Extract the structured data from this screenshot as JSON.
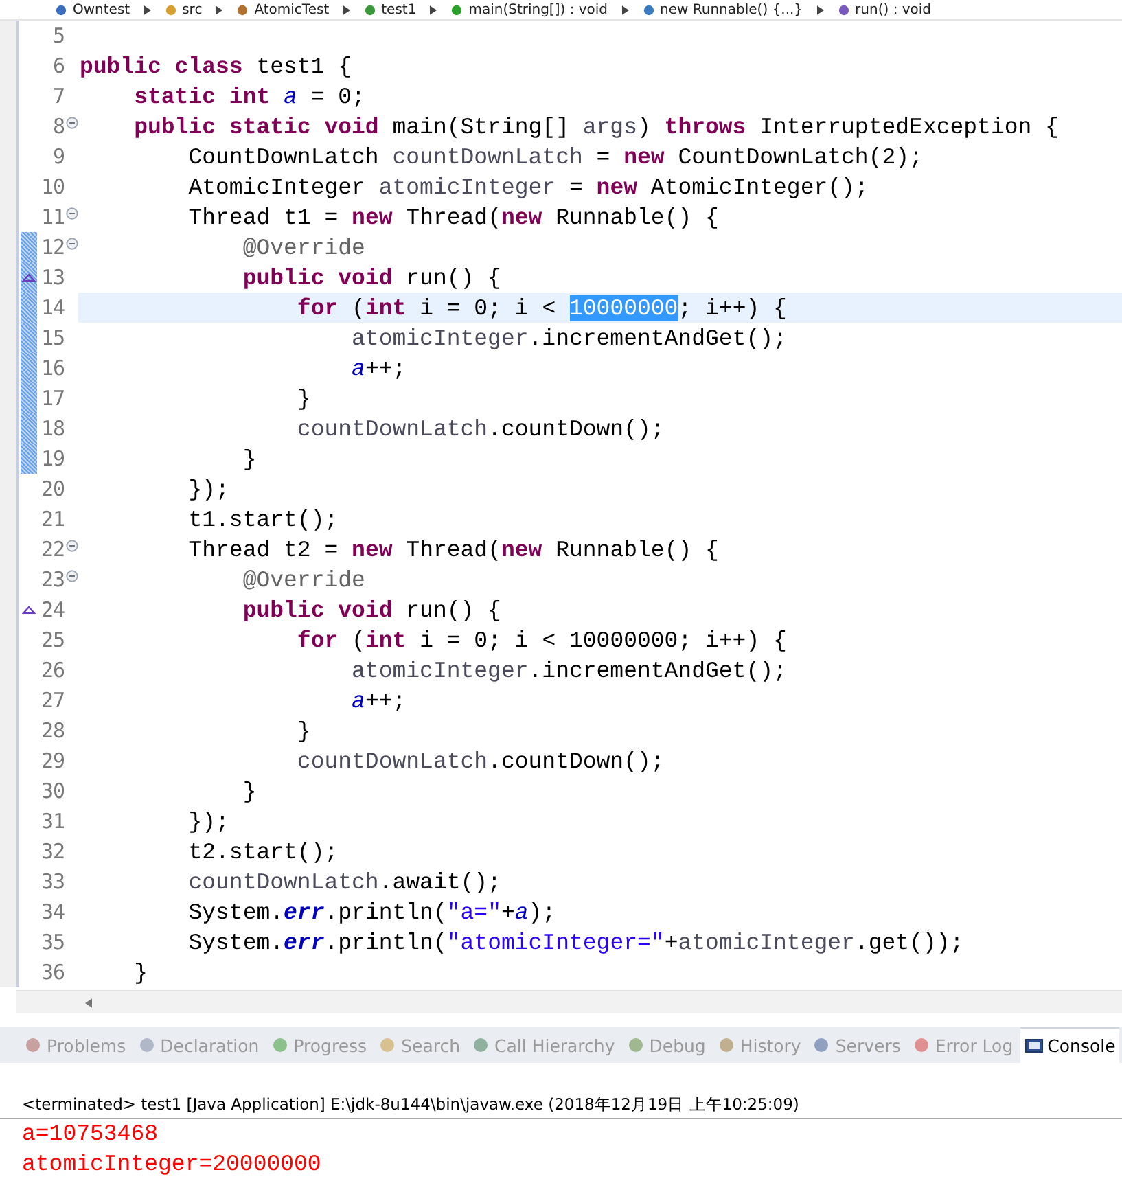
{
  "breadcrumb": [
    "Owntest",
    "src",
    "AtomicTest",
    "test1",
    "main(String[]) : void",
    "new Runnable() {...}",
    "run() : void"
  ],
  "editor": {
    "lines": [
      {
        "n": "5",
        "fold": false,
        "override": false,
        "scope": false,
        "current": false
      },
      {
        "n": "6",
        "fold": false,
        "override": false,
        "scope": false,
        "current": false,
        "tokens": [
          {
            "kind": "kw",
            "text": "public class"
          },
          {
            "kind": "p",
            "text": " test1 {"
          }
        ]
      },
      {
        "n": "7",
        "fold": false,
        "override": false,
        "scope": false,
        "current": false,
        "tokens": [
          {
            "kind": "kw",
            "text": "    static int "
          },
          {
            "kind": "sf",
            "text": "a"
          },
          {
            "kind": "p",
            "text": " = 0;"
          }
        ]
      },
      {
        "n": "8",
        "fold": true,
        "override": false,
        "scope": false,
        "current": false,
        "tokens": [
          {
            "kind": "kw",
            "text": "    public static void"
          },
          {
            "kind": "p",
            "text": " main(String[] "
          },
          {
            "kind": "v",
            "text": "args"
          },
          {
            "kind": "p",
            "text": ") "
          },
          {
            "kind": "kw",
            "text": "throws"
          },
          {
            "kind": "p",
            "text": " InterruptedException {"
          }
        ]
      },
      {
        "n": "9",
        "fold": false,
        "override": false,
        "scope": false,
        "current": false,
        "tokens": [
          {
            "kind": "p",
            "text": "        CountDownLatch "
          },
          {
            "kind": "v",
            "text": "countDownLatch"
          },
          {
            "kind": "p",
            "text": " = "
          },
          {
            "kind": "kw",
            "text": "new"
          },
          {
            "kind": "p",
            "text": " CountDownLatch(2);"
          }
        ]
      },
      {
        "n": "10",
        "fold": false,
        "override": false,
        "scope": false,
        "current": false,
        "tokens": [
          {
            "kind": "p",
            "text": "        AtomicInteger "
          },
          {
            "kind": "v",
            "text": "atomicInteger"
          },
          {
            "kind": "p",
            "text": " = "
          },
          {
            "kind": "kw",
            "text": "new"
          },
          {
            "kind": "p",
            "text": " AtomicInteger();"
          }
        ]
      },
      {
        "n": "11",
        "fold": true,
        "override": false,
        "scope": false,
        "current": false,
        "tokens": [
          {
            "kind": "p",
            "text": "        Thread t1 = "
          },
          {
            "kind": "kw",
            "text": "new"
          },
          {
            "kind": "p",
            "text": " Thread("
          },
          {
            "kind": "kw",
            "text": "new"
          },
          {
            "kind": "p",
            "text": " Runnable() {"
          }
        ]
      },
      {
        "n": "12",
        "fold": true,
        "override": false,
        "scope": true,
        "current": false,
        "tokens": [
          {
            "kind": "an",
            "text": "            @Override"
          }
        ]
      },
      {
        "n": "13",
        "fold": false,
        "override": true,
        "scope": true,
        "current": false,
        "tokens": [
          {
            "kind": "kw",
            "text": "            public void"
          },
          {
            "kind": "p",
            "text": " run() {"
          }
        ]
      },
      {
        "n": "14",
        "fold": false,
        "override": false,
        "scope": true,
        "current": true,
        "tokens": [
          {
            "kind": "kw",
            "text": "                for"
          },
          {
            "kind": "p",
            "text": " ("
          },
          {
            "kind": "kw",
            "text": "int"
          },
          {
            "kind": "p",
            "text": " i = 0; i < "
          },
          {
            "kind": "sel",
            "text": "10000000"
          },
          {
            "kind": "p",
            "text": "; i++) {"
          }
        ]
      },
      {
        "n": "15",
        "fold": false,
        "override": false,
        "scope": true,
        "current": false,
        "tokens": [
          {
            "kind": "v",
            "text": "                    atomicInteger"
          },
          {
            "kind": "p",
            "text": ".incrementAndGet();"
          }
        ]
      },
      {
        "n": "16",
        "fold": false,
        "override": false,
        "scope": true,
        "current": false,
        "tokens": [
          {
            "kind": "sf",
            "text": "                    a"
          },
          {
            "kind": "p",
            "text": "++;"
          }
        ]
      },
      {
        "n": "17",
        "fold": false,
        "override": false,
        "scope": true,
        "current": false,
        "tokens": [
          {
            "kind": "p",
            "text": "                }"
          }
        ]
      },
      {
        "n": "18",
        "fold": false,
        "override": false,
        "scope": true,
        "current": false,
        "tokens": [
          {
            "kind": "v",
            "text": "                countDownLatch"
          },
          {
            "kind": "p",
            "text": ".countDown();"
          }
        ]
      },
      {
        "n": "19",
        "fold": false,
        "override": false,
        "scope": true,
        "current": false,
        "tokens": [
          {
            "kind": "p",
            "text": "            }"
          }
        ]
      },
      {
        "n": "20",
        "fold": false,
        "override": false,
        "scope": false,
        "current": false,
        "tokens": [
          {
            "kind": "p",
            "text": "        });"
          }
        ]
      },
      {
        "n": "21",
        "fold": false,
        "override": false,
        "scope": false,
        "current": false,
        "tokens": [
          {
            "kind": "p",
            "text": "        t1.start();"
          }
        ]
      },
      {
        "n": "22",
        "fold": true,
        "override": false,
        "scope": false,
        "current": false,
        "tokens": [
          {
            "kind": "p",
            "text": "        Thread t2 = "
          },
          {
            "kind": "kw",
            "text": "new"
          },
          {
            "kind": "p",
            "text": " Thread("
          },
          {
            "kind": "kw",
            "text": "new"
          },
          {
            "kind": "p",
            "text": " Runnable() {"
          }
        ]
      },
      {
        "n": "23",
        "fold": true,
        "override": false,
        "scope": false,
        "current": false,
        "tokens": [
          {
            "kind": "an",
            "text": "            @Override"
          }
        ]
      },
      {
        "n": "24",
        "fold": false,
        "override": true,
        "scope": false,
        "current": false,
        "tokens": [
          {
            "kind": "kw",
            "text": "            public void"
          },
          {
            "kind": "p",
            "text": " run() {"
          }
        ]
      },
      {
        "n": "25",
        "fold": false,
        "override": false,
        "scope": false,
        "current": false,
        "tokens": [
          {
            "kind": "kw",
            "text": "                for"
          },
          {
            "kind": "p",
            "text": " ("
          },
          {
            "kind": "kw",
            "text": "int"
          },
          {
            "kind": "p",
            "text": " i = 0; i < 10000000; i++) {"
          }
        ]
      },
      {
        "n": "26",
        "fold": false,
        "override": false,
        "scope": false,
        "current": false,
        "tokens": [
          {
            "kind": "v",
            "text": "                    atomicInteger"
          },
          {
            "kind": "p",
            "text": ".incrementAndGet();"
          }
        ]
      },
      {
        "n": "27",
        "fold": false,
        "override": false,
        "scope": false,
        "current": false,
        "tokens": [
          {
            "kind": "sf",
            "text": "                    a"
          },
          {
            "kind": "p",
            "text": "++;"
          }
        ]
      },
      {
        "n": "28",
        "fold": false,
        "override": false,
        "scope": false,
        "current": false,
        "tokens": [
          {
            "kind": "p",
            "text": "                }"
          }
        ]
      },
      {
        "n": "29",
        "fold": false,
        "override": false,
        "scope": false,
        "current": false,
        "tokens": [
          {
            "kind": "v",
            "text": "                countDownLatch"
          },
          {
            "kind": "p",
            "text": ".countDown();"
          }
        ]
      },
      {
        "n": "30",
        "fold": false,
        "override": false,
        "scope": false,
        "current": false,
        "tokens": [
          {
            "kind": "p",
            "text": "            }"
          }
        ]
      },
      {
        "n": "31",
        "fold": false,
        "override": false,
        "scope": false,
        "current": false,
        "tokens": [
          {
            "kind": "p",
            "text": "        });"
          }
        ]
      },
      {
        "n": "32",
        "fold": false,
        "override": false,
        "scope": false,
        "current": false,
        "tokens": [
          {
            "kind": "p",
            "text": "        t2.start();"
          }
        ]
      },
      {
        "n": "33",
        "fold": false,
        "override": false,
        "scope": false,
        "current": false,
        "tokens": [
          {
            "kind": "v",
            "text": "        countDownLatch"
          },
          {
            "kind": "p",
            "text": ".await();"
          }
        ]
      },
      {
        "n": "34",
        "fold": false,
        "override": false,
        "scope": false,
        "current": false,
        "tokens": [
          {
            "kind": "p",
            "text": "        System."
          },
          {
            "kind": "st",
            "text": "err"
          },
          {
            "kind": "p",
            "text": ".println("
          },
          {
            "kind": "str",
            "text": "\"a=\""
          },
          {
            "kind": "p",
            "text": "+"
          },
          {
            "kind": "sf",
            "text": "a"
          },
          {
            "kind": "p",
            "text": ");"
          }
        ]
      },
      {
        "n": "35",
        "fold": false,
        "override": false,
        "scope": false,
        "current": false,
        "tokens": [
          {
            "kind": "p",
            "text": "        System."
          },
          {
            "kind": "st",
            "text": "err"
          },
          {
            "kind": "p",
            "text": ".println("
          },
          {
            "kind": "str",
            "text": "\"atomicInteger=\""
          },
          {
            "kind": "p",
            "text": "+"
          },
          {
            "kind": "v",
            "text": "atomicInteger"
          },
          {
            "kind": "p",
            "text": ".get());"
          }
        ]
      },
      {
        "n": "36",
        "fold": false,
        "override": false,
        "scope": false,
        "current": false,
        "tokens": [
          {
            "kind": "p",
            "text": "    }"
          }
        ]
      }
    ]
  },
  "tabs": [
    {
      "label": "Problems",
      "selected": false
    },
    {
      "label": "Declaration",
      "selected": false
    },
    {
      "label": "Progress",
      "selected": false
    },
    {
      "label": "Search",
      "selected": false
    },
    {
      "label": "Call Hierarchy",
      "selected": false
    },
    {
      "label": "Debug",
      "selected": false
    },
    {
      "label": "History",
      "selected": false
    },
    {
      "label": "Servers",
      "selected": false
    },
    {
      "label": "Error Log",
      "selected": false
    },
    {
      "label": "Console",
      "selected": true
    }
  ],
  "console": {
    "header": "<terminated> test1 [Java Application] E:\\jdk-8u144\\bin\\javaw.exe (2018年12月19日 上午10:25:09)",
    "output": [
      "a=10753468",
      "atomicInteger=20000000"
    ]
  }
}
